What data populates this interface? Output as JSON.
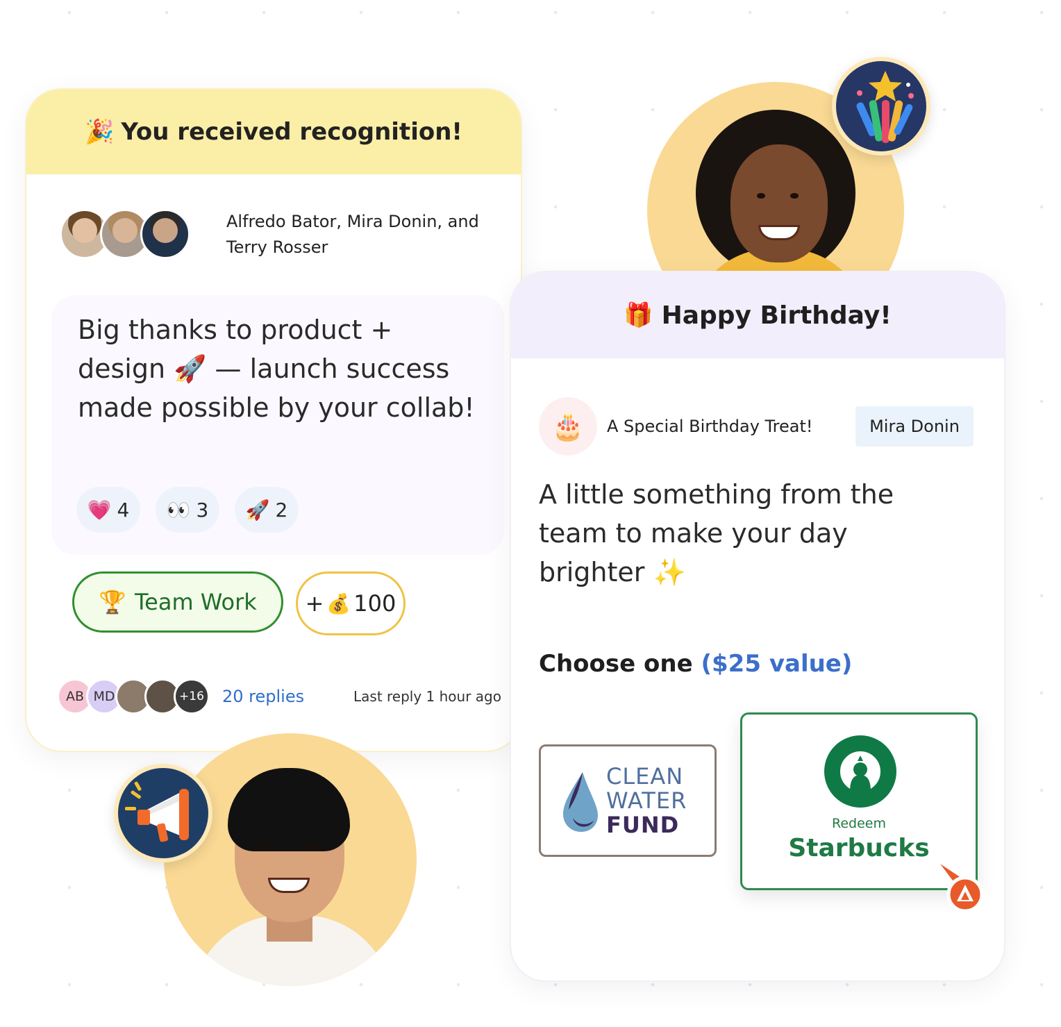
{
  "recognition": {
    "header_emoji": "🎉",
    "title": "You received recognition!",
    "givers": "Alfredo Bator, Mira Donin, and Terry Rosser",
    "message": "Big thanks to product + design 🚀 — launch success made possible by your collab!",
    "reactions": [
      {
        "emoji": "💗",
        "count": "4"
      },
      {
        "emoji": "👀",
        "count": "3"
      },
      {
        "emoji": "🚀",
        "count": "2"
      }
    ],
    "value_badge": {
      "emoji": "🏆",
      "label": "Team Work"
    },
    "points_badge": {
      "prefix": "+",
      "emoji": "💰",
      "amount": "100"
    },
    "reply_avatars": [
      "AB",
      "MD",
      "+16"
    ],
    "replies_label": "20 replies",
    "last_reply": "Last reply 1 hour ago"
  },
  "birthday": {
    "header_emoji": "🎁",
    "title": "Happy Birthday!",
    "cake_emoji": "🎂",
    "treat_label": "A Special Birthday Treat!",
    "sender": "Mira Donin",
    "message": "A little something from the team to make your day brighter ✨",
    "choose_label": "Choose one",
    "choose_value": "($25 value)",
    "options": {
      "clean_water": [
        "CLEAN",
        "WATER",
        "FUND"
      ],
      "starbucks_redeem": "Redeem",
      "starbucks_name": "Starbucks"
    }
  },
  "colors": {
    "recognition_header": "#fbeea6",
    "birthday_header": "#f3eefc",
    "team_work_green": "#2f8f2f",
    "points_gold": "#f0c245",
    "link_blue": "#2f6ec9",
    "starbucks_green": "#0f7a46"
  },
  "icons": {
    "fireworks_badge": "fireworks-icon",
    "megaphone_badge": "megaphone-icon",
    "cursor": "pointer-cursor-icon"
  }
}
